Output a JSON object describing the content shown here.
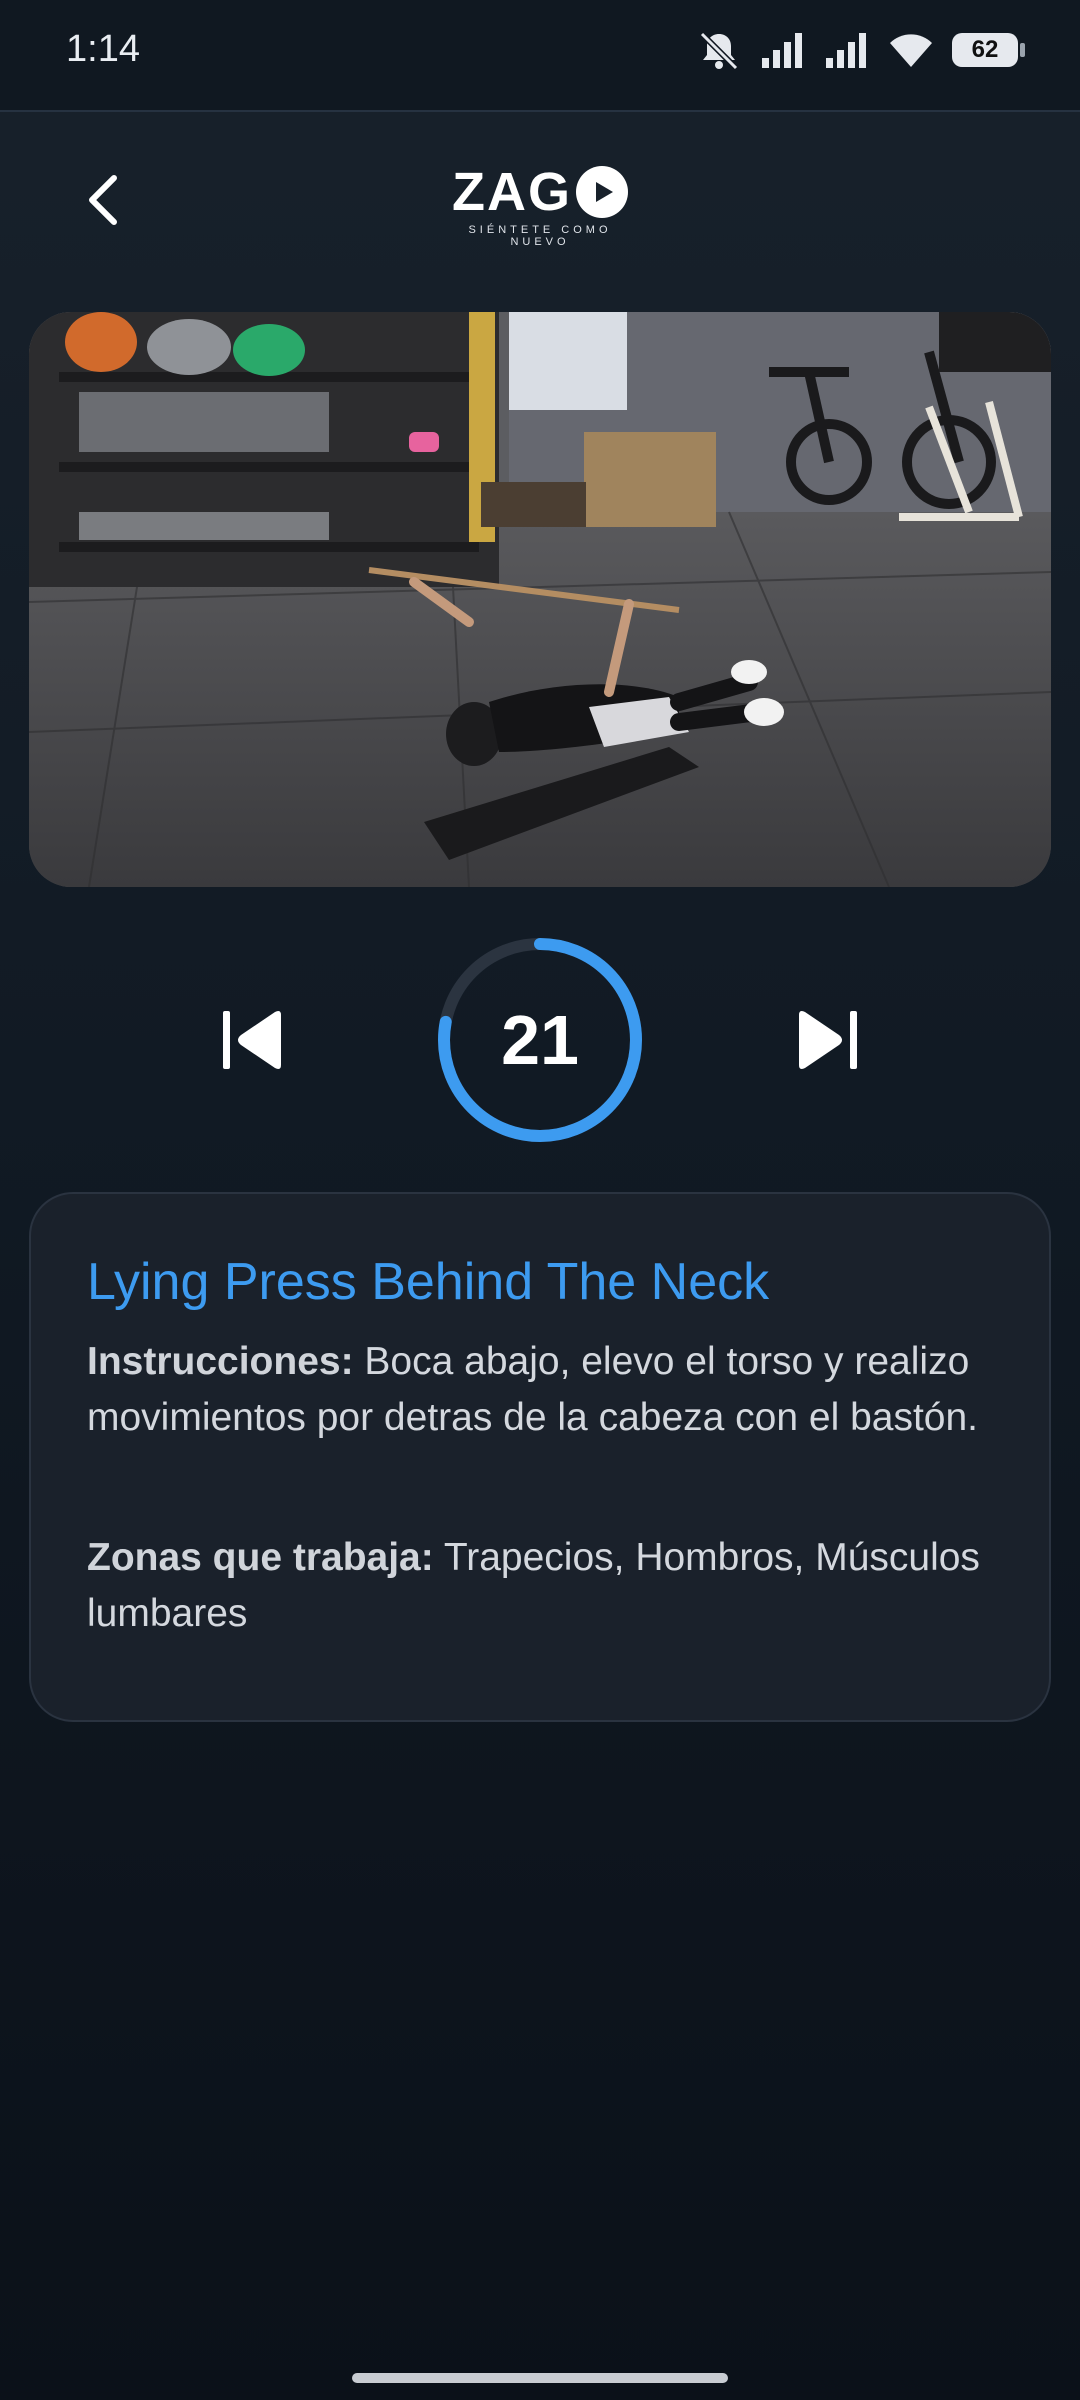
{
  "status_bar": {
    "time": "1:14",
    "battery": "62"
  },
  "header": {
    "logo_text": "ZAG",
    "tagline": "SIÉNTETE COMO NUEVO"
  },
  "player": {
    "timer_value": "21",
    "timer_progress": 0.78,
    "accent_color": "#3d9bf0"
  },
  "exercise": {
    "title": "Lying Press Behind The Neck",
    "instructions_label": "Instrucciones:",
    "instructions_text": " Boca abajo, elevo el torso y realizo movimientos por detras de la cabeza con el bastón.",
    "zones_label": "Zonas que trabaja:",
    "zones_text": " Trapecios, Hombros, Músculos lumbares"
  },
  "icons": [
    "back-arrow-icon",
    "skip-previous-icon",
    "skip-next-icon",
    "play-icon",
    "mute-icon",
    "signal-icon",
    "wifi-icon",
    "battery-icon"
  ]
}
